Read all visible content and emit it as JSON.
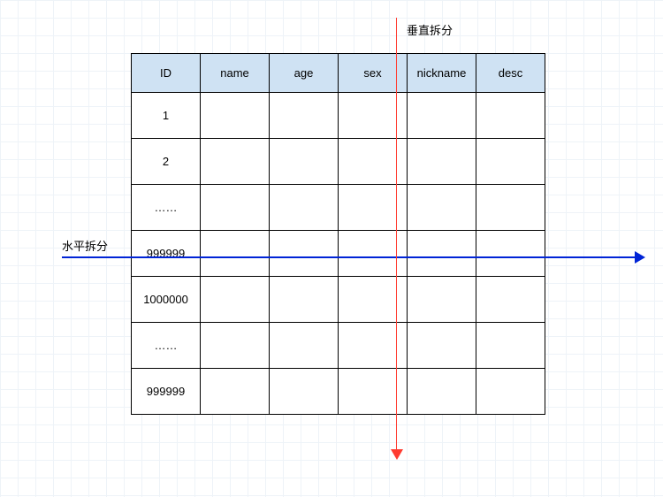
{
  "labels": {
    "vertical_split": "垂直拆分",
    "horizontal_split": "水平拆分"
  },
  "table": {
    "headers": [
      "ID",
      "name",
      "age",
      "sex",
      "nickname",
      "desc"
    ],
    "rows": [
      [
        "1",
        "",
        "",
        "",
        "",
        ""
      ],
      [
        "2",
        "",
        "",
        "",
        "",
        ""
      ],
      [
        "……",
        "",
        "",
        "",
        "",
        ""
      ],
      [
        "999999",
        "",
        "",
        "",
        "",
        ""
      ],
      [
        "1000000",
        "",
        "",
        "",
        "",
        ""
      ],
      [
        "……",
        "",
        "",
        "",
        "",
        ""
      ],
      [
        "999999",
        "",
        "",
        "",
        "",
        ""
      ]
    ]
  },
  "arrows": {
    "horizontal": {
      "color": "#0024d6",
      "direction": "right"
    },
    "vertical": {
      "color": "#ff3b30",
      "direction": "down"
    }
  }
}
